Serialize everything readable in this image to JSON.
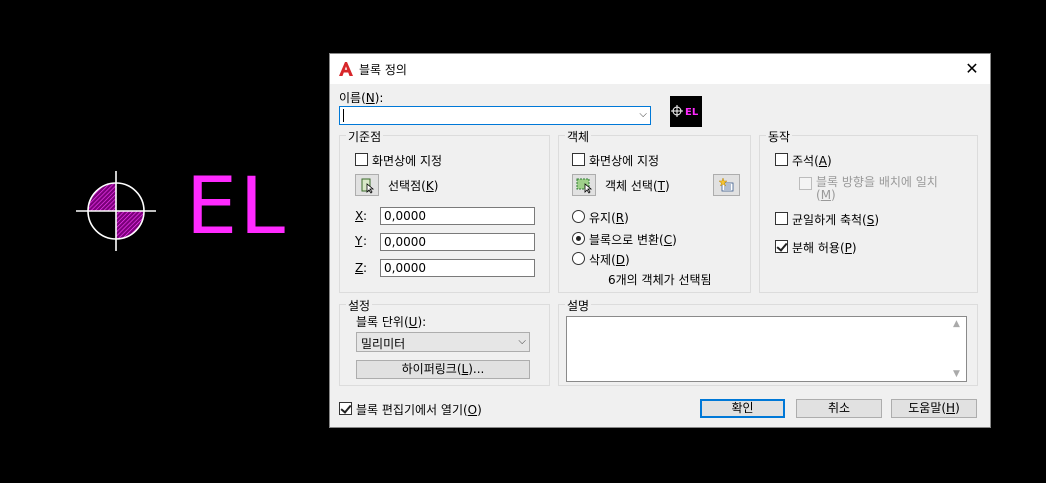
{
  "drawing": {
    "text": "EL",
    "text_color": "#ff2aff",
    "symbol_color": "#ffffff",
    "hatch_color": "#b400b4"
  },
  "dialog": {
    "title": "블록 정의",
    "close_glyph": "✕",
    "name_label": {
      "pre": "이름(",
      "key": "N",
      "post": "):"
    },
    "name_value": "",
    "base_point": {
      "title": "기준점",
      "specify_on_screen": "화면상에 지정",
      "pick_point": {
        "pre": "선택점(",
        "key": "K",
        "post": ")"
      },
      "x_label": "X",
      "y_label": "Y",
      "z_label": "Z",
      "x": "0,0000",
      "y": "0,0000",
      "z": "0,0000"
    },
    "objects": {
      "title": "객체",
      "specify_on_screen": "화면상에 지정",
      "select_objects": {
        "pre": "객체 선택(",
        "key": "T",
        "post": ")"
      },
      "retain": {
        "pre": "유지(",
        "key": "R",
        "post": ")"
      },
      "convert": {
        "pre": "블록으로 변환(",
        "key": "C",
        "post": ")"
      },
      "delete": {
        "pre": "삭제(",
        "key": "D",
        "post": ")"
      },
      "selected_status": "6개의 객체가 선택됨"
    },
    "behavior": {
      "title": "동작",
      "annotative": {
        "pre": "주석(",
        "key": "A",
        "post": ")"
      },
      "match_orientation": {
        "line1": "블록 방향을 배치에 일치",
        "pre": "(",
        "key": "M",
        "post": ")"
      },
      "scale_uniformly": {
        "pre": "균일하게 축척(",
        "key": "S",
        "post": ")"
      },
      "allow_exploding": {
        "pre": "분해 허용(",
        "key": "P",
        "post": ")"
      }
    },
    "settings": {
      "title": "설정",
      "block_unit": {
        "pre": "블록 단위(",
        "key": "U",
        "post": "):"
      },
      "unit_value": "밀리미터",
      "hyperlink": {
        "pre": "하이퍼링크(",
        "key": "L",
        "post": ")..."
      }
    },
    "description": {
      "title": "설명",
      "value": ""
    },
    "open_in_editor": {
      "pre": "블록 편집기에서 열기(",
      "key": "O",
      "post": ")"
    },
    "buttons": {
      "ok": "확인",
      "cancel": "취소",
      "help": {
        "pre": "도움말(",
        "key": "H",
        "post": ")"
      }
    }
  }
}
